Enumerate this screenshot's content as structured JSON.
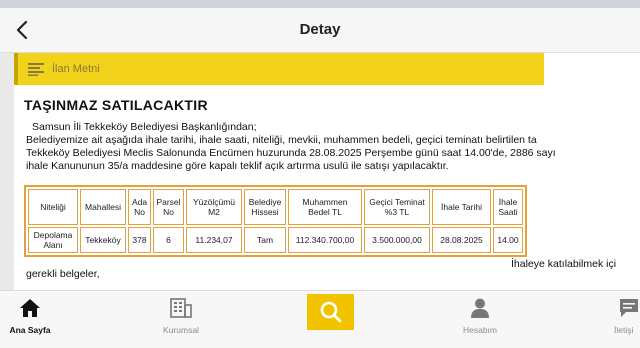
{
  "header": {
    "title": "Detay"
  },
  "tab": {
    "label": "İlan Metni"
  },
  "card": {
    "title": "TAŞINMAZ SATILACAKTIR",
    "lines": [
      "Samsun İli Tekkeköy Belediyesi Başkanlığından;",
      "Belediyemize ait aşağıda ihale tarihi, ihale saati, niteliği, mevkii, muhammen bedeli, geçici teminatı belirtilen ta",
      "Tekkeköy Belediyesi Meclis Salonunda Encümen huzurunda 28.08.2025 Perşembe günü saat 14.00'de, 2886 sayı",
      "ihale Kanununun 35/a maddesine göre kapalı teklif açık artırma usulü ile satışı yapılacaktır."
    ],
    "after_table": "İhaleye katılabilmek içi",
    "gerekli": "gerekli belgeler,"
  },
  "table": {
    "headers": [
      "Niteliği",
      "Mahallesi",
      "Ada No",
      "Parsel No",
      "Yüzölçümü M2",
      "Belediye Hissesi",
      "Muhammen Bedel TL",
      "Geçici Teminat %3 TL",
      "İhale Tarihi",
      "İhale Saati"
    ],
    "rows": [
      [
        "Depolama Alanı",
        "Tekkeköy",
        "378",
        "6",
        "11.234,07",
        "Tam",
        "112.340.700,00",
        "3.500.000,00",
        "28.08.2025",
        "14.00"
      ]
    ]
  },
  "nav": {
    "home": "Ana Sayfa",
    "kurumsal": "Kurumsal",
    "hesabim": "Hesabım",
    "settings": "İletişi"
  },
  "colors": {
    "accent": "#f2c400",
    "table_border": "#e3a23d"
  }
}
